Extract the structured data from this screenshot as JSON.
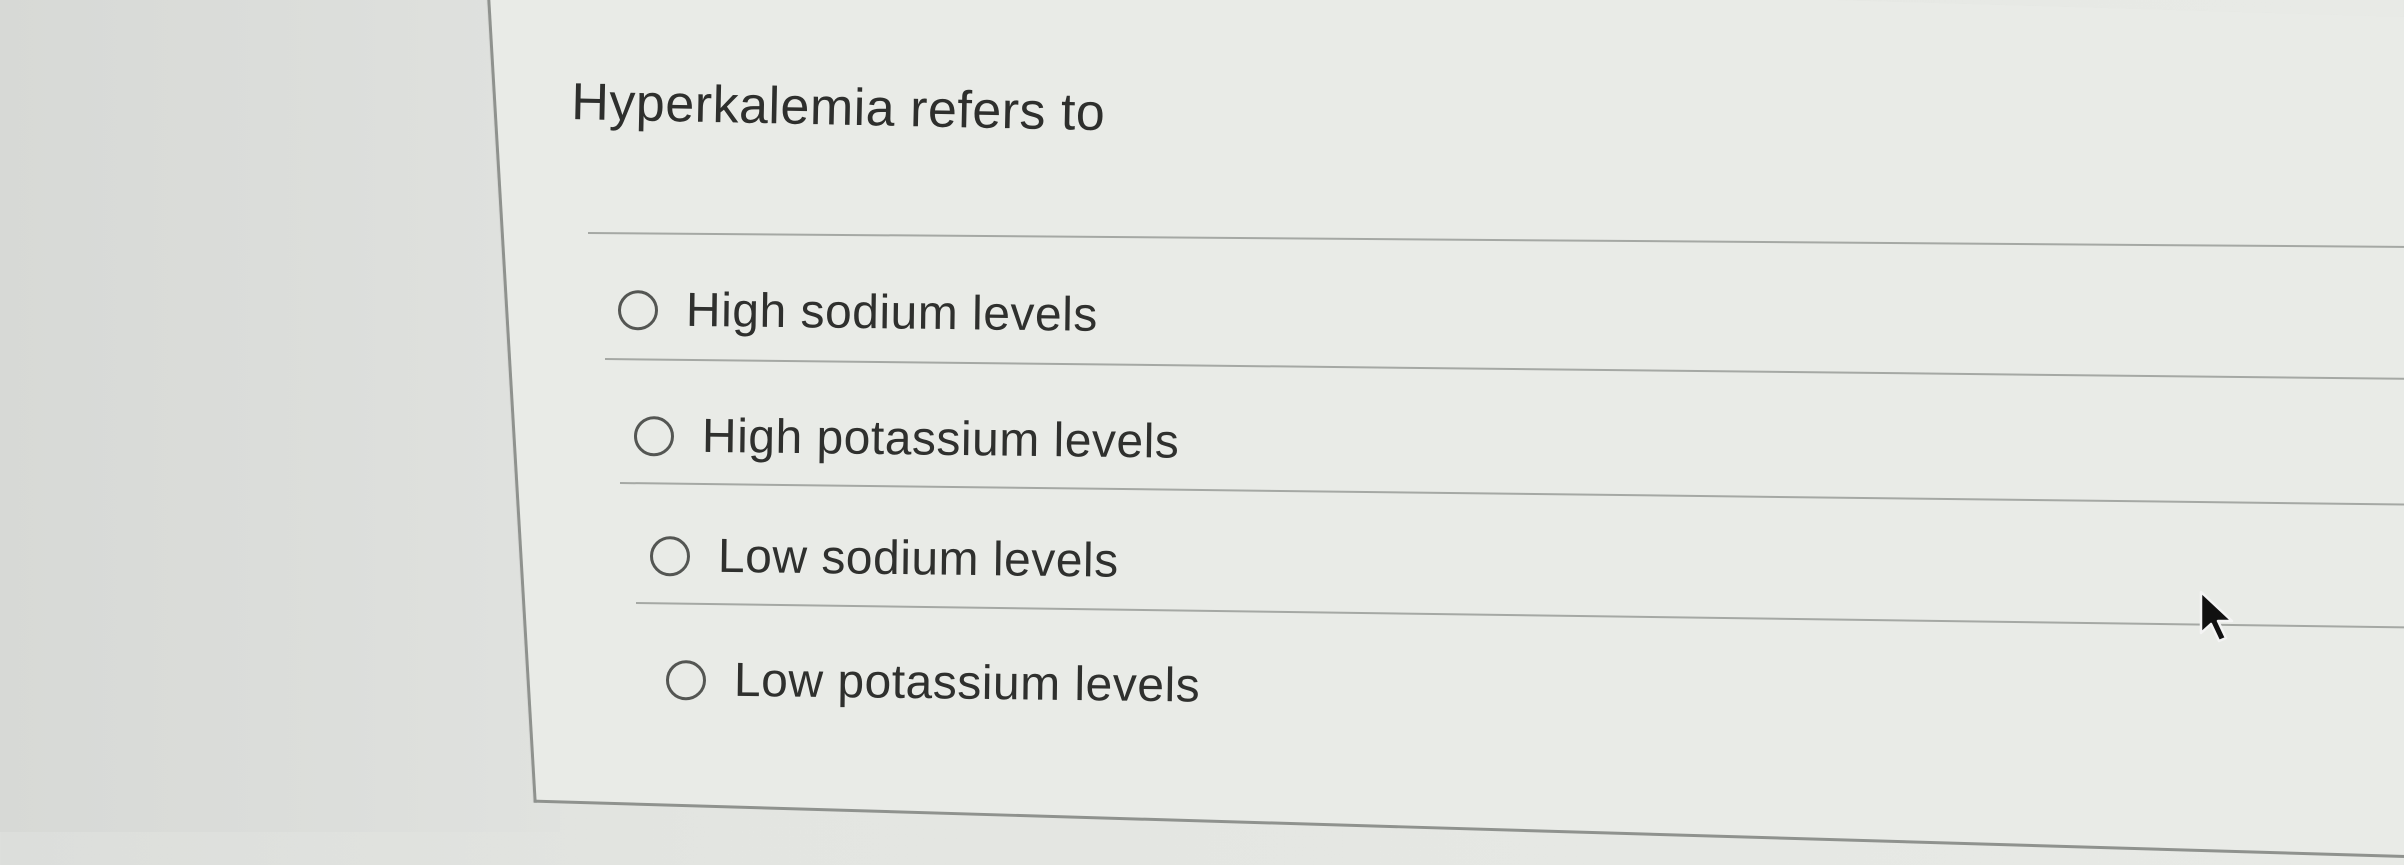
{
  "question": {
    "text": "Hyperkalemia refers to"
  },
  "options": [
    {
      "label": "High sodium levels",
      "selected": false
    },
    {
      "label": "High potassium levels",
      "selected": false
    },
    {
      "label": "Low sodium levels",
      "selected": false
    },
    {
      "label": "Low potassium levels",
      "selected": false
    }
  ],
  "icons": {
    "radio": "radio-circle",
    "cursor": "mouse-pointer-arrow"
  },
  "colors": {
    "background": "#e6e8e4",
    "card": "#e9ebe7",
    "text": "#2f302e",
    "divider": "#a5a8a4",
    "border": "#8f928e"
  }
}
